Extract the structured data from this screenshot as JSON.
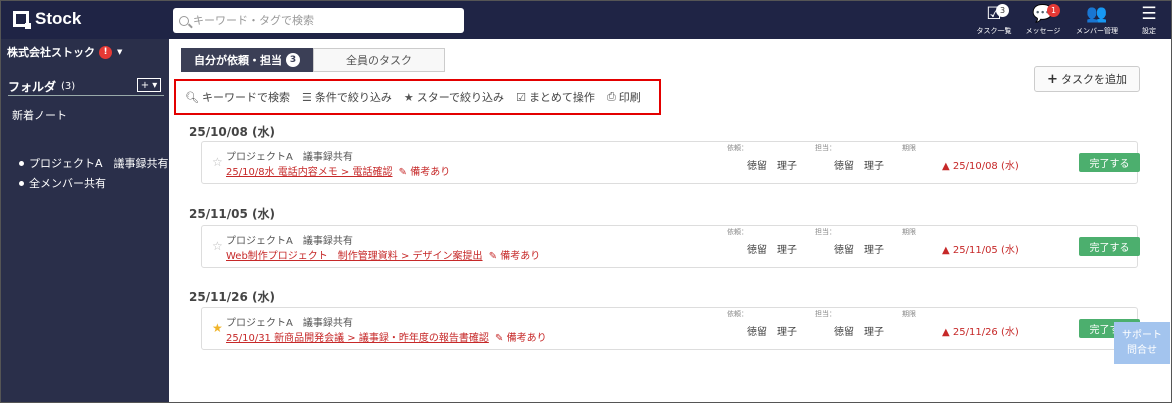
{
  "app": {
    "name": "Stock"
  },
  "search": {
    "placeholder": "キーワード・タグで検索"
  },
  "header_icons": [
    {
      "label": "タスク一覧",
      "icon": "checkbox-icon",
      "badge": "3"
    },
    {
      "label": "メッセージ",
      "icon": "chat-icon",
      "badge": "1"
    },
    {
      "label": "メンバー管理",
      "icon": "members-icon"
    },
    {
      "label": "設定",
      "icon": "hamburger-icon"
    }
  ],
  "sidebar": {
    "company": "株式会社ストック",
    "folder_label": "フォルダ",
    "folder_count": "(3)",
    "new_note": "新着ノート",
    "items": [
      "プロジェクトA　議事録共有",
      "全メンバー共有"
    ]
  },
  "tabs": [
    {
      "label": "自分が依頼・担当",
      "badge": "3"
    },
    {
      "label": "全員のタスク"
    }
  ],
  "toolbar": {
    "items": [
      {
        "label": "キーワードで検索",
        "icon": "search-icon"
      },
      {
        "label": "条件で絞り込み",
        "icon": "list-icon"
      },
      {
        "label": "スターで絞り込み",
        "icon": "star-icon"
      },
      {
        "label": "まとめて操作",
        "icon": "checkbox-icon"
      },
      {
        "label": "印刷",
        "icon": "printer-icon"
      }
    ]
  },
  "add_task": "タスクを追加",
  "columns": {
    "requester": "依頼：",
    "assignee": "担当：",
    "due": "期限"
  },
  "groups": [
    {
      "date": "25/10/08 (水)",
      "task": {
        "project": "プロジェクトA　議事録共有",
        "link": "25/10/8水 電話内容メモ > 電話確認",
        "note": "備考あり",
        "requester": "徳留　理子",
        "assignee": "徳留　理子",
        "due": "25/10/08 (水)",
        "starred": false,
        "done_label": "完了する"
      }
    },
    {
      "date": "25/11/05 (水)",
      "task": {
        "project": "プロジェクトA　議事録共有",
        "link": "Web制作プロジェクト　制作管理資料 > デザイン案提出",
        "note": "備考あり",
        "requester": "徳留　理子",
        "assignee": "徳留　理子",
        "due": "25/11/05 (水)",
        "starred": false,
        "done_label": "完了する"
      }
    },
    {
      "date": "25/11/26 (水)",
      "task": {
        "project": "プロジェクトA　議事録共有",
        "link": "25/10/31 新商品開発会議 > 議事録・昨年度の報告書確認",
        "note": "備考あり",
        "requester": "徳留　理子",
        "assignee": "徳留　理子",
        "due": "25/11/26 (水)",
        "starred": true,
        "done_label": "完了する"
      }
    }
  ],
  "support": {
    "line1": "サポート",
    "line2": "問合せ"
  },
  "colors": {
    "header": "#1f2445",
    "sidebar": "#2a2f4a",
    "accent_red": "#c62828",
    "done_green": "#4caf6e",
    "highlight_border": "#e30000"
  }
}
